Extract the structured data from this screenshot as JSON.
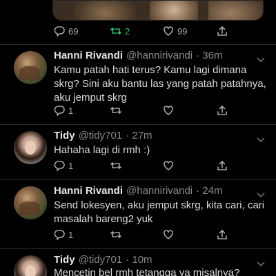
{
  "top_tweet": {
    "stats": {
      "replies": "69",
      "retweets": "2",
      "likes": "99"
    }
  },
  "replies": [
    {
      "name": "Hanni Rivandi",
      "handle": "@hannirivandi",
      "time": "· 36m",
      "text": "Kamu patah hati terus? Kamu lagi dimana skrg? Sini aku bantu las yang patah patahnya, aku jemput skrg",
      "reply_count": "1"
    },
    {
      "name": "Tidy",
      "handle": "@tidy701",
      "time": "· 27m",
      "text": "Hahaha lagi di rmh :)",
      "reply_count": "1"
    },
    {
      "name": "Hanni Rivandi",
      "handle": "@hannirivandi",
      "time": "· 24m",
      "text": "Send lokesyen, aku jemput skrg, kita cari, cari masalah bareng2 yuk",
      "reply_count": "1"
    },
    {
      "name": "Tidy",
      "handle": "@tidy701",
      "time": "· 10m",
      "text": "Mencetin bel rmh tetangga ya misalnya?"
    }
  ],
  "icons": {
    "reply": "reply-icon",
    "retweet": "retweet-icon",
    "like": "heart-icon",
    "share": "share-icon",
    "more": "chevron-down-icon"
  },
  "colors": {
    "background": "#000000",
    "retweet_active": "#2fbf71",
    "muted": "#8a8a8a"
  }
}
